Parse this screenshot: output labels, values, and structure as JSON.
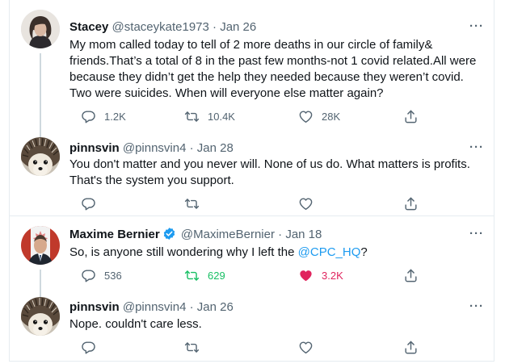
{
  "tweets": [
    {
      "name": "Stacey",
      "handle": "@staceykate1973",
      "dot": "·",
      "date": "Jan 26",
      "lines": [
        "My mom called today to tell of 2 more deaths in our circle of family&",
        "friends.That’s a total of 8 in the past few months-not 1 covid related.All were",
        "because they didn’t get the help they needed because they weren’t covid.",
        "Two were suicides. When will everyone else matter again?"
      ],
      "replies": "1.2K",
      "retweets": "10.4K",
      "likes": "28K"
    },
    {
      "name": "pinnsvin",
      "handle": "@pinnsvin4",
      "dot": "·",
      "date": "Jan 28",
      "lines": [
        "You don't matter and you never will. None of us do. What matters is profits.",
        "That's the system you support."
      ],
      "replies": "",
      "retweets": "",
      "likes": ""
    },
    {
      "name": "Maxime Bernier",
      "handle": "@MaximeBernier",
      "dot": "·",
      "date": "Jan 18",
      "text_before": "So, is anyone still wondering why I left the ",
      "mention": "@CPC_HQ",
      "text_after": "?",
      "replies": "536",
      "retweets": "629",
      "likes": "3.2K",
      "retweet_color": "#17bf63",
      "like_color": "#e0245e"
    },
    {
      "name": "pinnsvin",
      "handle": "@pinnsvin4",
      "dot": "·",
      "date": "Jan 26",
      "lines": [
        "Nope. couldn't care less."
      ],
      "replies": "",
      "retweets": "",
      "likes": ""
    }
  ],
  "more_label": "···",
  "colors": {
    "accent": "#1d9bf0",
    "muted": "#536471",
    "retweet": "#17bf63",
    "like": "#e0245e"
  },
  "icons": [
    "reply-icon",
    "retweet-icon",
    "like-icon",
    "share-icon",
    "verified-badge-icon"
  ]
}
